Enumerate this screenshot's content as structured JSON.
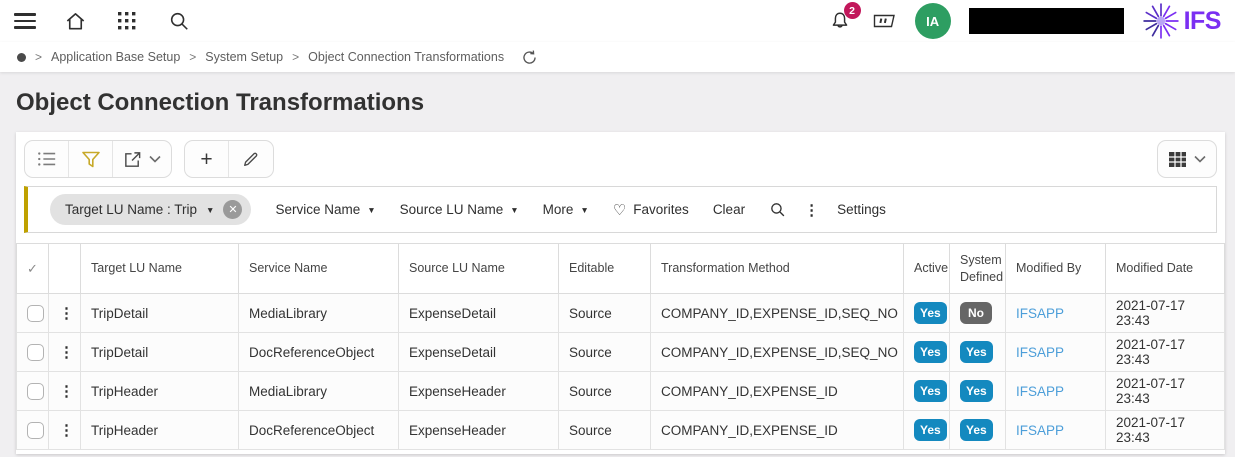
{
  "topbar": {
    "notification_count": "2",
    "avatar_initials": "IA",
    "brand": "IFS"
  },
  "breadcrumb": {
    "items": [
      "Application Base Setup",
      "System Setup",
      "Object Connection Transformations"
    ]
  },
  "page": {
    "title": "Object Connection Transformations"
  },
  "icons": {
    "kebab": "⋮",
    "caret_down": "▼",
    "heart": "♡",
    "check": "✓",
    "close": "✕",
    "plus": "+",
    "breadcrumb_separator": ">"
  },
  "filterbar": {
    "chip_label": "Target LU Name : Trip",
    "filters": [
      "Service Name",
      "Source LU Name",
      "More"
    ],
    "favorites": "Favorites",
    "clear": "Clear",
    "settings": "Settings"
  },
  "table": {
    "columns": [
      "Target LU Name",
      "Service Name",
      "Source LU Name",
      "Editable",
      "Transformation Method",
      "Active",
      "System Defined",
      "Modified By",
      "Modified Date"
    ],
    "rows": [
      {
        "target_lu": "TripDetail",
        "service": "MediaLibrary",
        "source_lu": "ExpenseDetail",
        "editable": "Source",
        "method": "COMPANY_ID,EXPENSE_ID,SEQ_NO",
        "active": "Yes",
        "system_defined": "No",
        "modified_by": "IFSAPP",
        "modified_date": "2021-07-17 23:43"
      },
      {
        "target_lu": "TripDetail",
        "service": "DocReferenceObject",
        "source_lu": "ExpenseDetail",
        "editable": "Source",
        "method": "COMPANY_ID,EXPENSE_ID,SEQ_NO",
        "active": "Yes",
        "system_defined": "Yes",
        "modified_by": "IFSAPP",
        "modified_date": "2021-07-17 23:43"
      },
      {
        "target_lu": "TripHeader",
        "service": "MediaLibrary",
        "source_lu": "ExpenseHeader",
        "editable": "Source",
        "method": "COMPANY_ID,EXPENSE_ID",
        "active": "Yes",
        "system_defined": "Yes",
        "modified_by": "IFSAPP",
        "modified_date": "2021-07-17 23:43"
      },
      {
        "target_lu": "TripHeader",
        "service": "DocReferenceObject",
        "source_lu": "ExpenseHeader",
        "editable": "Source",
        "method": "COMPANY_ID,EXPENSE_ID",
        "active": "Yes",
        "system_defined": "Yes",
        "modified_by": "IFSAPP",
        "modified_date": "2021-07-17 23:43"
      }
    ]
  },
  "colors": {
    "accent_yellow": "#bfa100",
    "badge_yes_blue": "#1489bf",
    "badge_no_gray": "#666666",
    "link_blue": "#4c9ed9",
    "avatar_green": "#2e9e62",
    "notification_pink": "#c2175b",
    "brand_purple": "#7b2ff2"
  }
}
